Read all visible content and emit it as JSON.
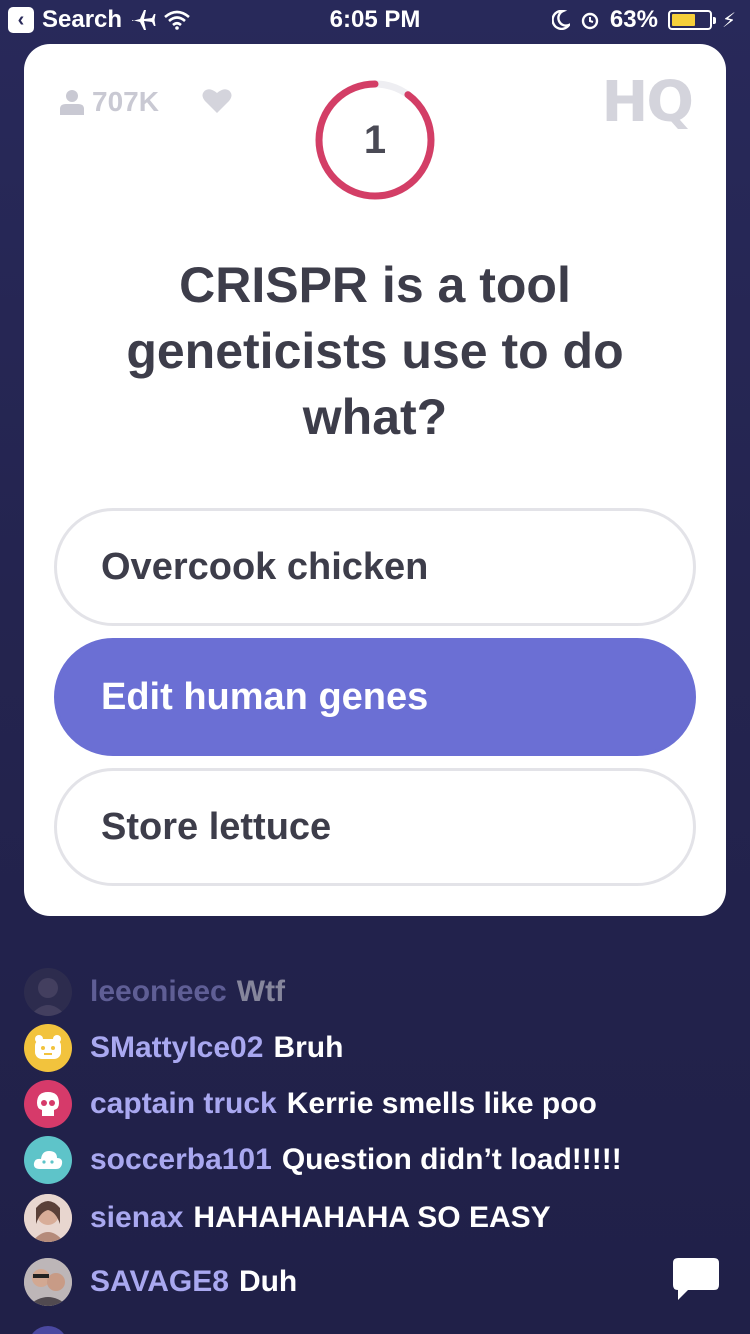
{
  "status_bar": {
    "back_app": "Search",
    "time": "6:05 PM",
    "battery_percent": "63%",
    "battery_level": 0.63
  },
  "card": {
    "viewer_count": "707K",
    "logo": "HQ",
    "timer": {
      "value": "1",
      "progress": 0.9,
      "color": "#d33e66"
    },
    "question": "CRISPR is a tool geneticists use to do what?",
    "answers": [
      {
        "label": "Overcook chicken",
        "selected": false
      },
      {
        "label": "Edit human genes",
        "selected": true
      },
      {
        "label": "Store lettuce",
        "selected": false
      }
    ],
    "accent": "#6b6fd4"
  },
  "chat": {
    "messages": [
      {
        "user": "leeonieec",
        "text": "Wtf",
        "avatar": "photo"
      },
      {
        "user": "SMattyIce02",
        "text": "Bruh",
        "avatar": "yellow-face-icon"
      },
      {
        "user": "captain truck",
        "text": "Kerrie smells like poo",
        "avatar": "pink-skull-icon"
      },
      {
        "user": "soccerba101",
        "text": "Question didn’t load!!!!!",
        "avatar": "teal-cloud-icon"
      },
      {
        "user": "sienax",
        "text": "HAHAHAHAHA SO EASY",
        "avatar": "photo"
      },
      {
        "user": "SAVAGE8",
        "text": "Duh",
        "avatar": "photo"
      }
    ]
  }
}
